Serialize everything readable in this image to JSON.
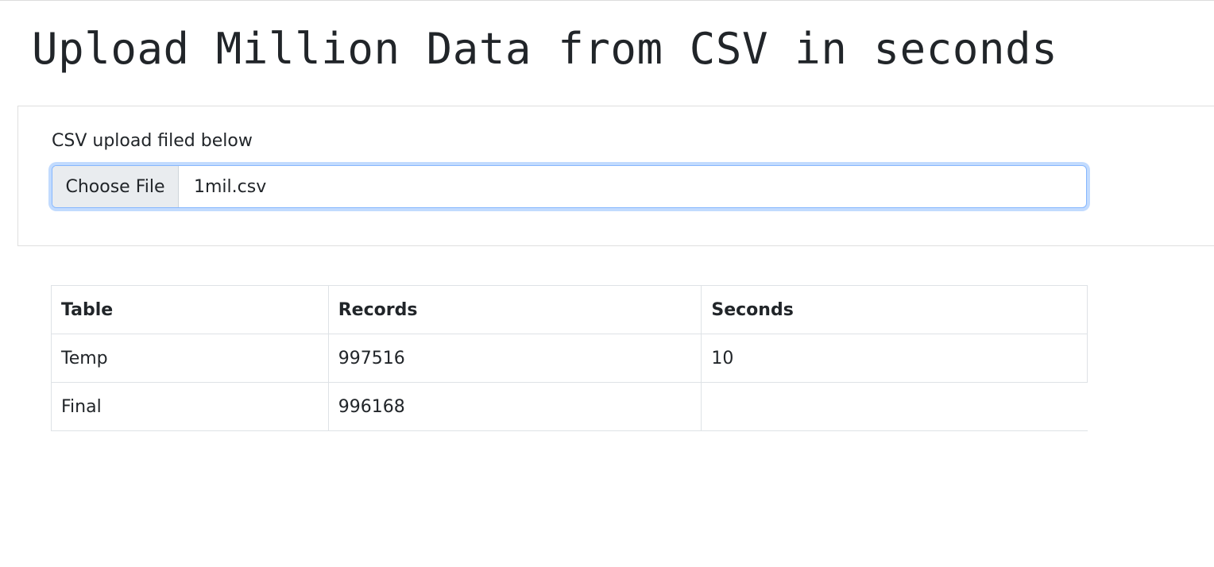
{
  "page": {
    "title": "Upload Million Data from CSV in seconds"
  },
  "upload": {
    "label": "CSV upload filed below",
    "button_label": "Choose File",
    "file_name": "1mil.csv"
  },
  "results": {
    "headers": [
      "Table",
      "Records",
      "Seconds"
    ],
    "rows": [
      [
        "Temp",
        "997516",
        "10"
      ],
      [
        "Final",
        "996168",
        ""
      ]
    ]
  }
}
